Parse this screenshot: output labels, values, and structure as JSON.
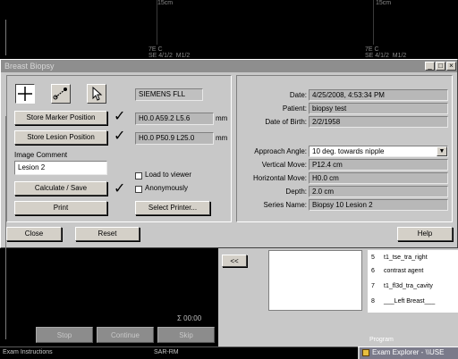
{
  "viewer": {
    "top_dim_a": "15cm",
    "top_dim_b": "15cm",
    "overlay_left": "7E C\nSE 4/1/2  M1/2",
    "overlay_right": "7E C\nSE 4/1/2  M1/2"
  },
  "dialog": {
    "title": "Breast Biopsy",
    "window_buttons": [
      "_",
      "□",
      "×"
    ],
    "system_label": "SIEMENS FLL",
    "store_marker_label": "Store Marker Position",
    "store_lesion_label": "Store Lesion Position",
    "marker_value": "H0.0 A59.2 L5.6",
    "lesion_value": "H0.0 P50.9 L25.0",
    "unit": "mm",
    "image_comment_label": "Image Comment",
    "image_comment_value": "Lesion 2",
    "calculate_label": "Calculate / Save",
    "print_label": "Print",
    "load_to_viewer_label": "Load to viewer",
    "anonymously_label": "Anonymously",
    "select_printer_label": "Select Printer...",
    "info": {
      "date_label": "Date:",
      "date_value": "4/25/2008, 4:53:34 PM",
      "patient_label": "Patient:",
      "patient_value": "biopsy test",
      "dob_label": "Date of Birth:",
      "dob_value": "2/2/1958",
      "approach_label": "Approach Angle:",
      "approach_value": "10 deg. towards nipple",
      "vertical_label": "Vertical Move:",
      "vertical_value": "P12.4 cm",
      "horizontal_label": "Horizontal Move:",
      "horizontal_value": "H0.0 cm",
      "depth_label": "Depth:",
      "depth_value": "2.0 cm",
      "series_label": "Series Name:",
      "series_value": "Biopsy 10 Lesion 2"
    },
    "close_label": "Close",
    "reset_label": "Reset",
    "help_label": "Help"
  },
  "lower": {
    "nav_label": "<<",
    "series": [
      {
        "num": "5",
        "name": "t1_tse_tra_right"
      },
      {
        "num": "6",
        "name": "contrast agent"
      },
      {
        "num": "7",
        "name": "t1_fl3d_tra_cavity"
      },
      {
        "num": "8",
        "name": "___Left Breast___"
      }
    ],
    "program_label": "Program",
    "timer": "Σ 00:00",
    "stop_label": "Stop",
    "continue_label": "Continue",
    "skip_label": "Skip"
  },
  "status": {
    "left": "Exam Instructions",
    "center": "SAR-RM",
    "task_label": "Exam Explorer - \\\\USE"
  }
}
